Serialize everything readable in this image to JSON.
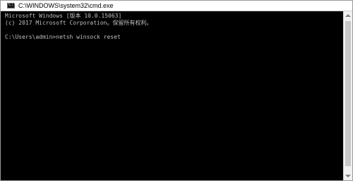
{
  "window": {
    "title": "C:\\WINDOWS\\system32\\cmd.exe",
    "icon": "cmd-icon",
    "icon_glyph": "C:\\"
  },
  "console": {
    "lines": [
      "Microsoft Windows [版本 10.0.15063]",
      "(c) 2017 Microsoft Corporation。保留所有权利。",
      "C:\\Users\\admin>netsh winsock reset"
    ],
    "text_color": "#c0c0c0",
    "background_color": "#000000"
  },
  "colors": {
    "titlebar": "#ffffff",
    "scrollbar": "#f0f0f0",
    "scroll_thumb": "#c8c8c8"
  }
}
